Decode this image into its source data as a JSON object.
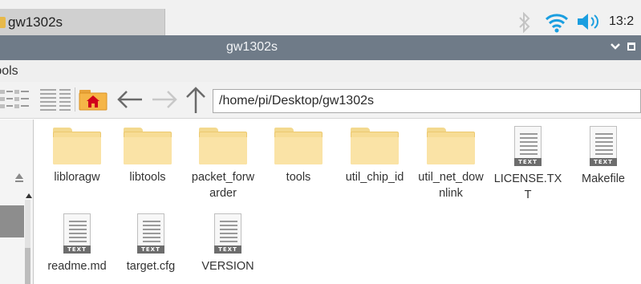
{
  "taskbar": {
    "window_button_label": "gw1302s",
    "clock": "13:2"
  },
  "window": {
    "title": "gw1302s"
  },
  "menubar": {
    "tools_label": "ools",
    "tools_prefix": ")"
  },
  "toolbar": {
    "path": "/home/pi/Desktop/gw1302s"
  },
  "colors": {
    "titlebar": "#6f7b88",
    "folder": "#f7dc95",
    "home_folder": "#f5a623",
    "home_roof": "#d0021b"
  },
  "files": [
    {
      "name": "liblorag w",
      "label": "liblorag",
      "label2": "w",
      "type": "folder"
    },
    {
      "name": "libtools",
      "label": "libtools",
      "label2": "",
      "type": "folder"
    },
    {
      "name": "packet_forwarder",
      "label": "packet_forw",
      "label2": "arder",
      "type": "folder"
    },
    {
      "name": "tools",
      "label": "tools",
      "label2": "",
      "type": "folder"
    },
    {
      "name": "util_chip_id",
      "label": "util_chip_id",
      "label2": "",
      "type": "folder"
    },
    {
      "name": "util_net_downlink",
      "label": "util_net_dow",
      "label2": "nlink",
      "type": "folder"
    },
    {
      "name": "LICENSE.TXT",
      "label": "LICENSE.TX",
      "label2": "T",
      "type": "text"
    },
    {
      "name": "Makefile",
      "label": "Makefile",
      "label2": "",
      "type": "text"
    },
    {
      "name": "readme.md",
      "label": "readme.md",
      "label2": "",
      "type": "text"
    },
    {
      "name": "target.cfg",
      "label": "target.cfg",
      "label2": "",
      "type": "text"
    },
    {
      "name": "VERSION",
      "label": "VERSION",
      "label2": "",
      "type": "text"
    }
  ],
  "text_badge": "TEXT"
}
